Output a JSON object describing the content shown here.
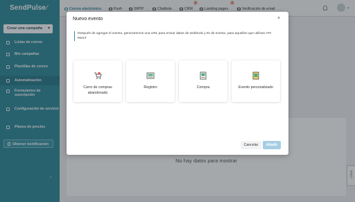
{
  "app": {
    "logo": "SendPulse",
    "logo_mark": "⁄"
  },
  "sidebar": {
    "create_label": "Crear una campaña",
    "items": [
      {
        "label": "Listas de correo",
        "icon": "list-icon"
      },
      {
        "label": "Mis campañas",
        "icon": "campaign-icon"
      },
      {
        "label": "Plantillas de correo",
        "icon": "template-icon"
      },
      {
        "label": "Automatización",
        "icon": "automation-icon",
        "active": true
      },
      {
        "label": "Formularios de suscripción",
        "icon": "form-icon"
      },
      {
        "label": "Configuración de servicio",
        "icon": "settings-icon"
      },
      {
        "label": "Planes de precios",
        "icon": "pricing-icon"
      }
    ],
    "upgrade_label": "Obtener bonificación",
    "collapse_glyph": "‹"
  },
  "topnav": {
    "items": [
      {
        "label": "Correo electrónico",
        "active": true
      },
      {
        "label": "Push"
      },
      {
        "label": "SMTP"
      },
      {
        "label": "Chatbots"
      },
      {
        "label": "CRM",
        "badge": "β"
      },
      {
        "label": "Landing pages",
        "badge": "β"
      },
      {
        "label": "Verificación de email"
      }
    ]
  },
  "page": {
    "empty_text": "No hay datos para mostrar",
    "side_tab": "Chats"
  },
  "modal": {
    "title": "Nuevo evento",
    "close_glyph": "×",
    "description": "Después de agregar el evento, generaremos una URL para enviar datos de webhook y ID de evento, para aquellos que utilizan API REST",
    "options": [
      {
        "label": "Carro de compras abandonado",
        "icon": "cart-icon"
      },
      {
        "label": "Registro",
        "icon": "registration-icon"
      },
      {
        "label": "Compra",
        "icon": "purchase-icon"
      },
      {
        "label": "Evento personalizado",
        "icon": "custom-event-icon"
      }
    ],
    "cancel_label": "Cancelar",
    "add_label": "Añadir"
  },
  "colors": {
    "sidebar": "#2f8a9c",
    "accent": "#2f8a9c",
    "add_disabled": "#a6cde3"
  }
}
